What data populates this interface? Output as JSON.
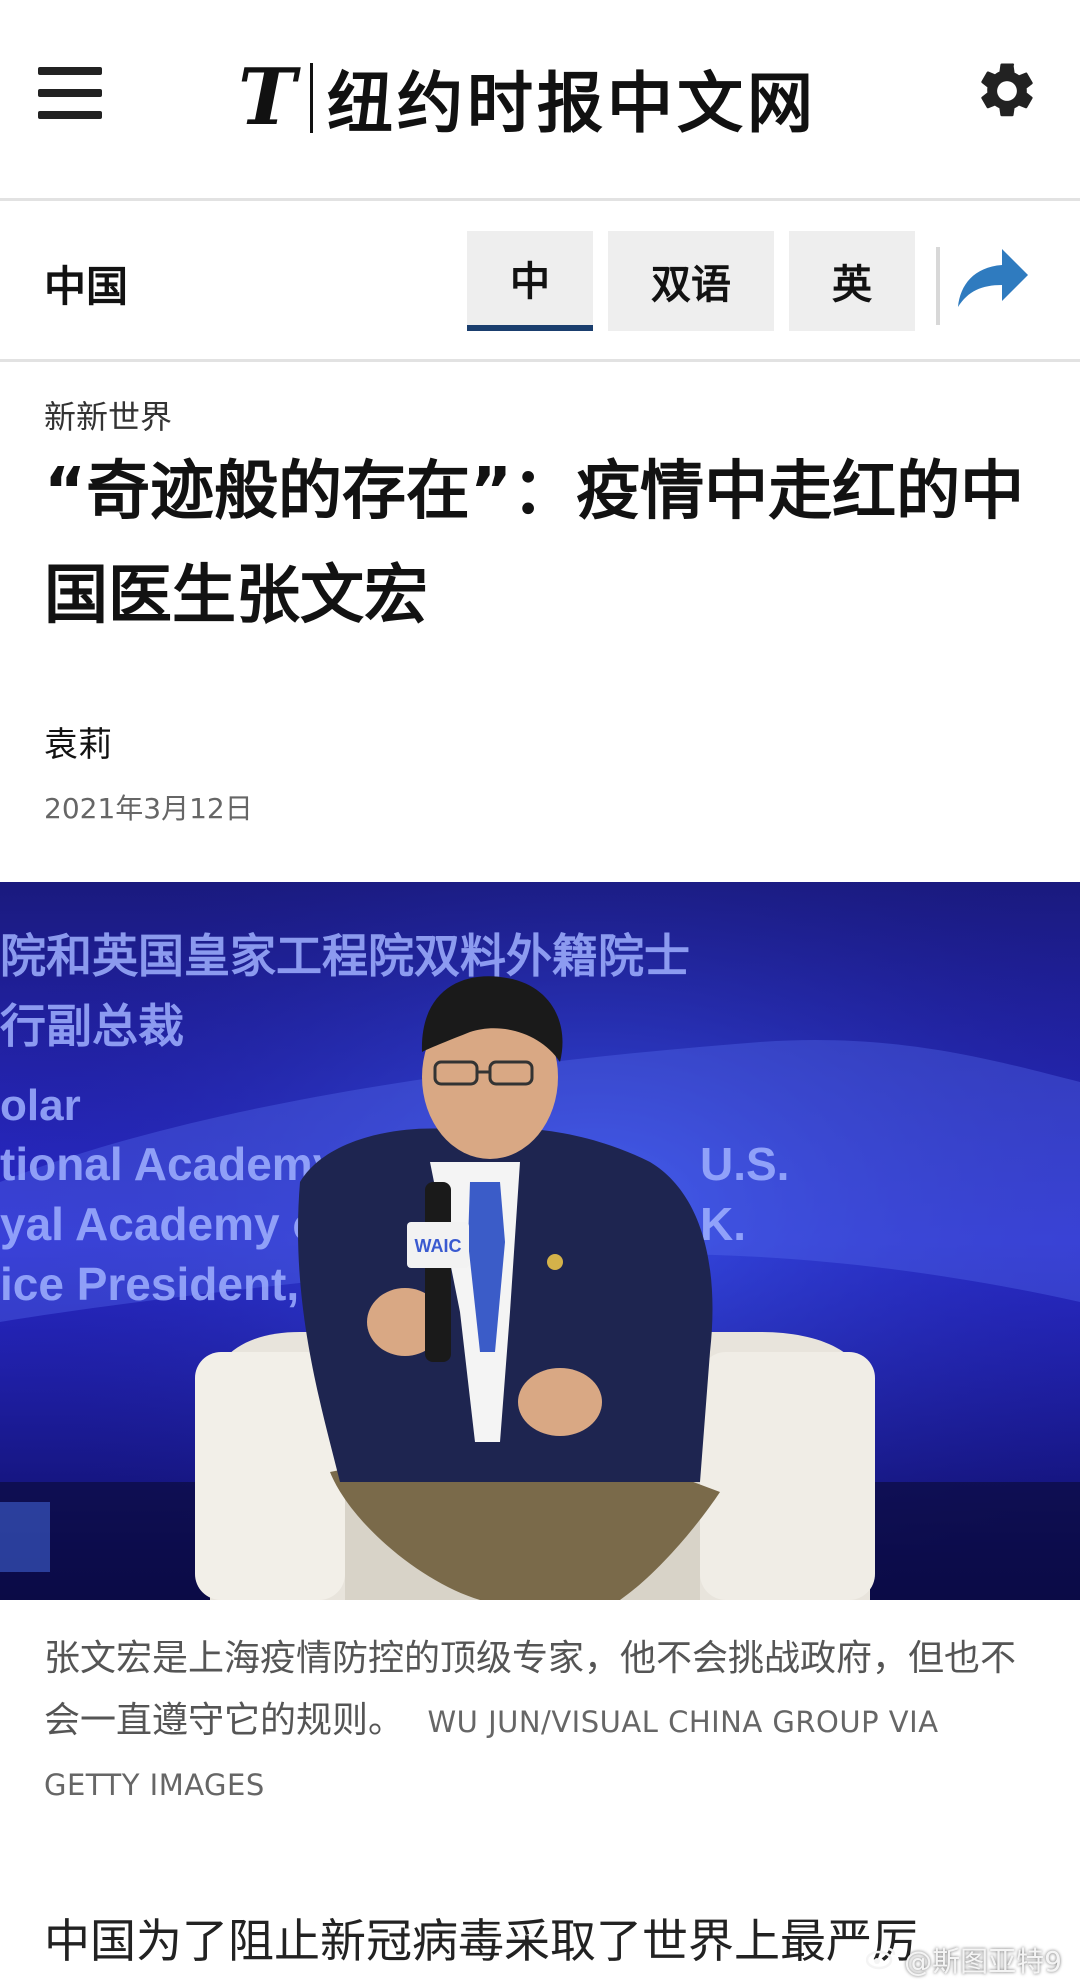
{
  "header": {
    "logo_mark": "T",
    "logo_text": "纽约时报中文网"
  },
  "section_bar": {
    "section": "中国",
    "tabs": [
      {
        "label": "中",
        "active": true
      },
      {
        "label": "双语",
        "active": false
      },
      {
        "label": "英",
        "active": false
      }
    ]
  },
  "article": {
    "kicker": "新新世界",
    "headline": "“奇迹般的存在”：疫情中走红的中国医生张文宏",
    "author": "袁莉",
    "date": "2021年3月12日",
    "photo_backdrop_lines": [
      "院和英国皇家工程院双料外籍院士",
      "行副总裁",
      "olar",
      "tional Academy of E",
      "yal Academy of E",
      "ice President, M"
    ],
    "photo_backdrop_right": [
      "U.S.",
      "K."
    ],
    "mic_label": "WAIC",
    "caption": "张文宏是上海疫情防控的顶级专家，他不会挑战政府，但也不会一直遵守它的规则。",
    "credit": "WU JUN/VISUAL CHINA GROUP VIA GETTY IMAGES",
    "lead": "中国为了阻止新冠病毒采取了世界上最严厉"
  },
  "watermark": "@斯图亚特9",
  "colors": {
    "tab_underline": "#1a3e6e",
    "share_arrow": "#2f7bbf",
    "tab_bg": "#eeeeee",
    "photo_bg": "#1e1ea0"
  }
}
